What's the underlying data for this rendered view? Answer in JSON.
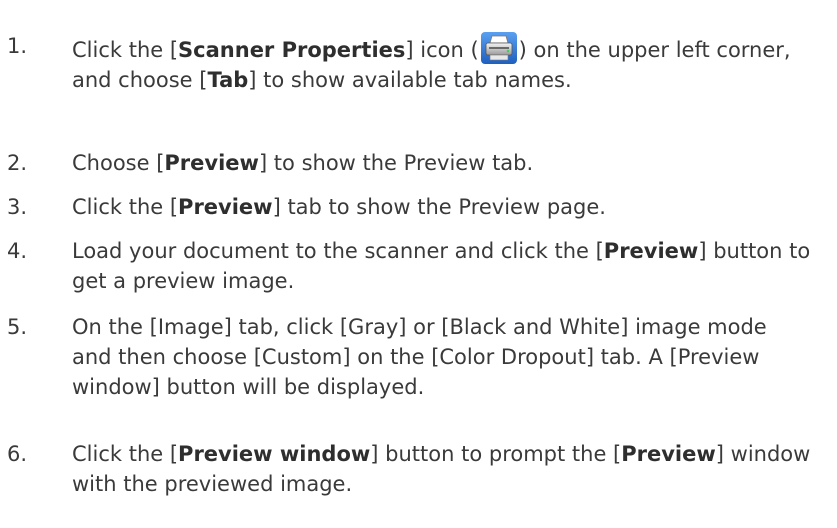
{
  "steps": [
    {
      "num": "1.",
      "t1": "Click the [",
      "b1": "Scanner Properties",
      "t2": "] icon (",
      "icon": "scanner-properties-icon",
      "t3": ") on the upper left corner, and choose [",
      "b2": "Tab",
      "t4": "] to show available tab names."
    },
    {
      "num": "2.",
      "t1": "Choose [",
      "b1": "Preview",
      "t2": "] to show the Preview tab."
    },
    {
      "num": "3.",
      "t1": "Click the [",
      "b1": "Preview",
      "t2": "] tab to show the Preview page."
    },
    {
      "num": "4.",
      "t1": "Load your document to the scanner and click the [",
      "b1": "Preview",
      "t2": "] button to get a preview image."
    },
    {
      "num": "5.",
      "t1": "On the [Image] tab, click [Gray] or [Black and White] image mode and then choose [Custom] on the [Color Dropout] tab. A [Preview window] button will be displayed."
    },
    {
      "num": "6.",
      "t1": "Click the [",
      "b1": "Preview window",
      "t2": "] button to prompt the [",
      "b2": "Preview",
      "t3": "] window with the previewed image."
    }
  ]
}
